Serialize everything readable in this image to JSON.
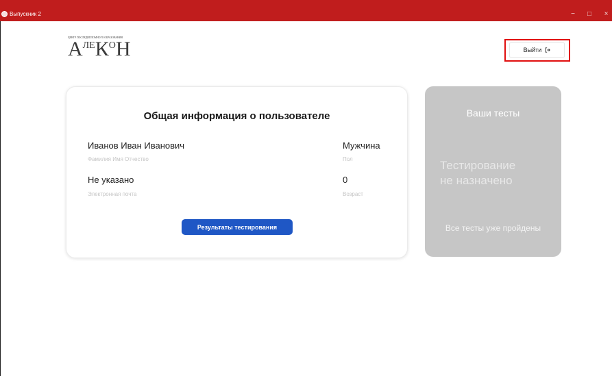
{
  "window": {
    "title": "Выпускник 2",
    "controls": {
      "minimize": "−",
      "maximize": "□",
      "close": "×"
    }
  },
  "logo": {
    "caption": "ЦЕНТР ПОСЛЕДИПЛОМНОГО ОБРАЗОВАНИЯ",
    "letters": [
      "А",
      "ЛЕ",
      "К",
      "О",
      "Н"
    ]
  },
  "header": {
    "logout_label": "Выйти",
    "logout_icon": "logout-icon"
  },
  "user_card": {
    "title": "Общая информация о пользователе",
    "full_name": {
      "value": "Иванов Иван Иванович",
      "label": "Фамилия Имя Отчество"
    },
    "gender": {
      "value": "Мужчина",
      "label": "Пол"
    },
    "email": {
      "value": "Не указано",
      "label": "Электронная почта"
    },
    "age": {
      "value": "0",
      "label": "Возраст"
    },
    "results_button": "Результаты тестирования"
  },
  "tests_panel": {
    "title": "Ваши тесты",
    "status_line1": "Тестирование",
    "status_line2": "не назначено",
    "note": "Все тесты уже пройдены"
  },
  "colors": {
    "titlebar": "#c01d1d",
    "highlight": "#e00e0e",
    "primary_button": "#1f57c5",
    "tests_panel": "#c6c6c6"
  }
}
